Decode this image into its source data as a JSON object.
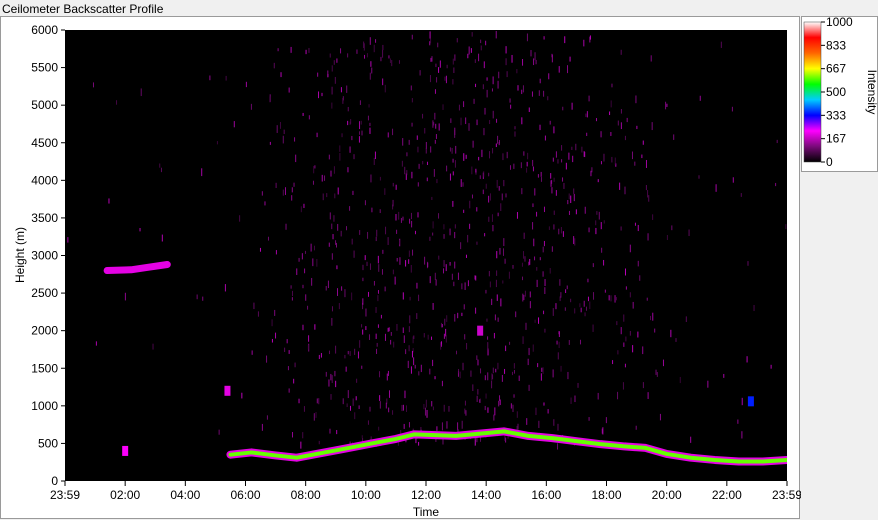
{
  "window": {
    "title": "Ceilometer Backscatter Profile"
  },
  "chart_data": {
    "type": "heatmap",
    "title": "Ceilometer Backscatter Profile",
    "xlabel": "Time",
    "ylabel": "Height (m)",
    "xlim": [
      "23:59",
      "23:59"
    ],
    "x_ticks": [
      "23:59",
      "02:00",
      "04:00",
      "06:00",
      "08:00",
      "10:00",
      "12:00",
      "14:00",
      "16:00",
      "18:00",
      "20:00",
      "22:00",
      "23:59"
    ],
    "ylim": [
      0,
      6000
    ],
    "y_ticks": [
      0,
      500,
      1000,
      1500,
      2000,
      2500,
      3000,
      3500,
      4000,
      4500,
      5000,
      5500,
      6000
    ],
    "grid": false,
    "colorbar": {
      "label": "Intensity",
      "range": [
        0,
        1000
      ],
      "ticks": [
        "1000",
        "833",
        "667",
        "500",
        "333",
        "167",
        "0"
      ],
      "colors": [
        "#000000",
        "#7a0a7a",
        "#ff00ff",
        "#0000ff",
        "#00ccff",
        "#00ff00",
        "#ffff00",
        "#ff6600",
        "#ff0000",
        "#ffffff"
      ]
    },
    "cloud_base_layer": {
      "intensity": 600,
      "points": [
        {
          "time_h": 5.5,
          "height_m": 350
        },
        {
          "time_h": 6.2,
          "height_m": 380
        },
        {
          "time_h": 7.0,
          "height_m": 340
        },
        {
          "time_h": 7.7,
          "height_m": 310
        },
        {
          "time_h": 8.5,
          "height_m": 370
        },
        {
          "time_h": 9.3,
          "height_m": 430
        },
        {
          "time_h": 10.2,
          "height_m": 500
        },
        {
          "time_h": 11.0,
          "height_m": 560
        },
        {
          "time_h": 11.6,
          "height_m": 620
        },
        {
          "time_h": 12.3,
          "height_m": 610
        },
        {
          "time_h": 13.0,
          "height_m": 600
        },
        {
          "time_h": 13.8,
          "height_m": 630
        },
        {
          "time_h": 14.6,
          "height_m": 660
        },
        {
          "time_h": 15.4,
          "height_m": 600
        },
        {
          "time_h": 16.2,
          "height_m": 570
        },
        {
          "time_h": 17.0,
          "height_m": 530
        },
        {
          "time_h": 17.8,
          "height_m": 490
        },
        {
          "time_h": 18.6,
          "height_m": 460
        },
        {
          "time_h": 19.3,
          "height_m": 440
        },
        {
          "time_h": 20.0,
          "height_m": 360
        },
        {
          "time_h": 20.8,
          "height_m": 310
        },
        {
          "time_h": 21.6,
          "height_m": 280
        },
        {
          "time_h": 22.4,
          "height_m": 260
        },
        {
          "time_h": 23.2,
          "height_m": 260
        },
        {
          "time_h": 24.0,
          "height_m": 280
        }
      ]
    },
    "upper_layer": {
      "intensity": 200,
      "points": [
        {
          "time_h": 1.4,
          "height_m": 2800
        },
        {
          "time_h": 2.2,
          "height_m": 2810
        },
        {
          "time_h": 2.7,
          "height_m": 2840
        },
        {
          "time_h": 3.4,
          "height_m": 2880
        }
      ]
    },
    "low_patches": [
      {
        "time_h": 2.0,
        "height_m": 400,
        "intensity": 220
      },
      {
        "time_h": 5.4,
        "height_m": 1200,
        "intensity": 200
      },
      {
        "time_h": 13.8,
        "height_m": 2000,
        "intensity": 180
      },
      {
        "time_h": 22.8,
        "height_m": 1060,
        "intensity": 350
      }
    ],
    "noise_region": {
      "intensity_max": 167,
      "time_h": [
        6,
        20
      ],
      "height_m": [
        500,
        6000
      ]
    }
  }
}
